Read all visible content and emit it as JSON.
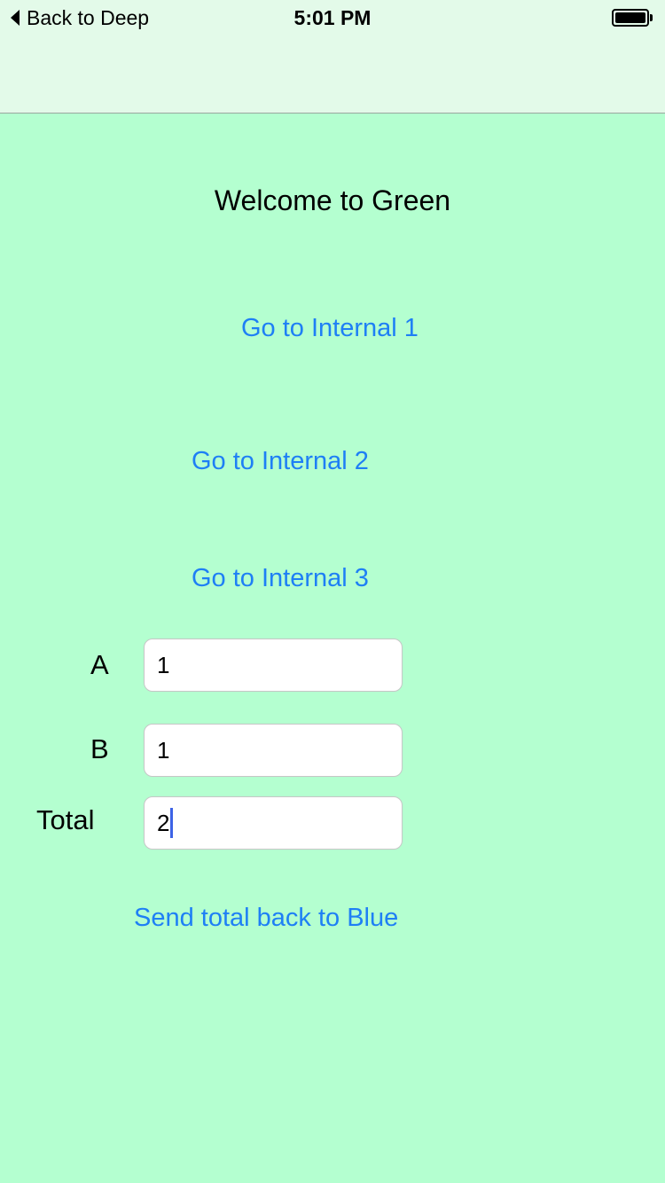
{
  "status_bar": {
    "back_label": "Back to Deep",
    "time": "5:01 PM",
    "battery_level": 1.0
  },
  "screen": {
    "title": "Welcome to Green",
    "links": {
      "internal_1": "Go to Internal 1",
      "internal_2": "Go to Internal 2",
      "internal_3": "Go to Internal 3",
      "send_total": "Send total back to Blue"
    },
    "fields": {
      "a": {
        "label": "A",
        "value": "1"
      },
      "b": {
        "label": "B",
        "value": "1"
      },
      "total": {
        "label": "Total",
        "value": "2"
      }
    }
  },
  "colors": {
    "background": "#b4ffd0",
    "nav_background": "#e3fae9",
    "link": "#1e7ff5",
    "caret": "#3d63e6"
  },
  "icons": {
    "back": "chevron-left-icon",
    "battery": "battery-icon"
  }
}
